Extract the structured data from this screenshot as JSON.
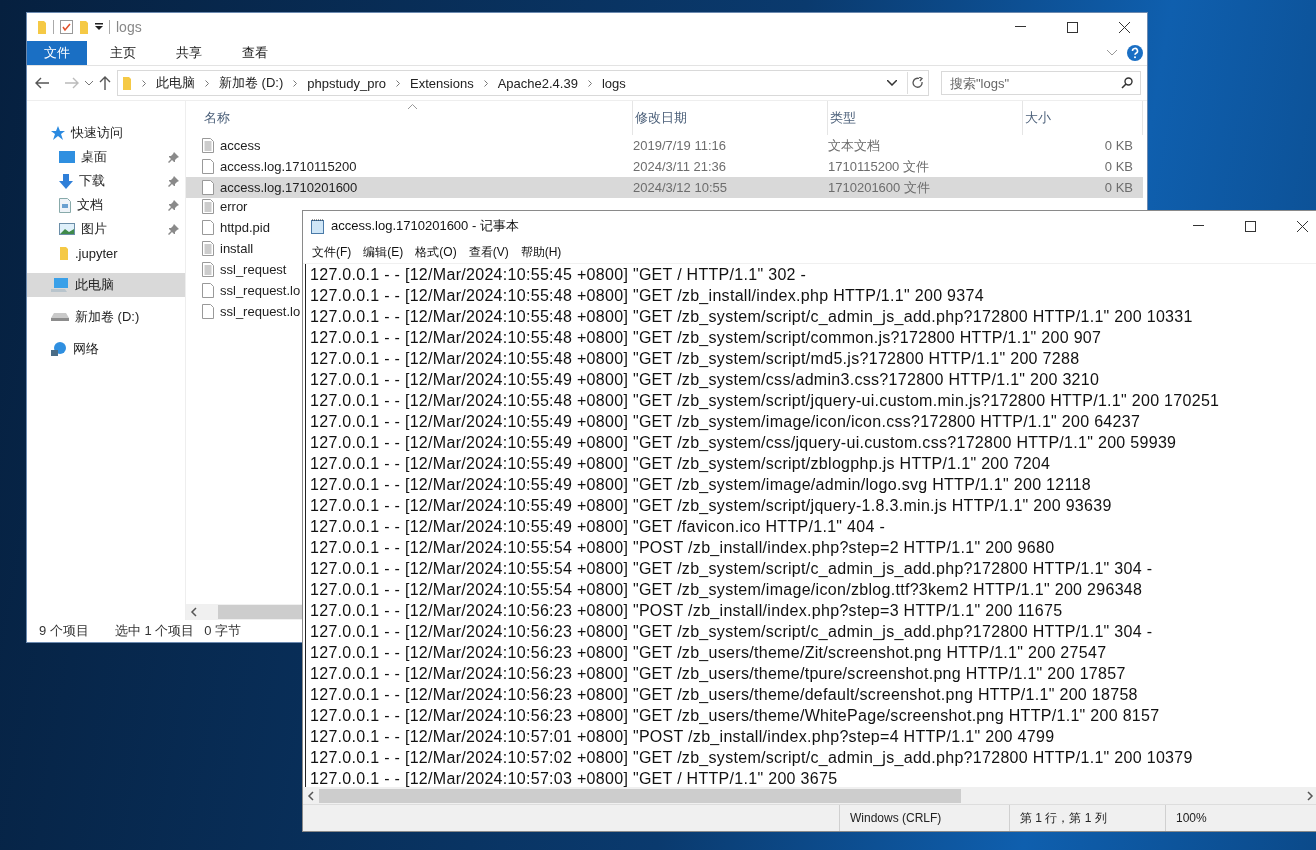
{
  "explorer": {
    "title": "logs",
    "ribbon_tabs": [
      {
        "label": "文件",
        "selected": true
      },
      {
        "label": "主页",
        "selected": false
      },
      {
        "label": "共享",
        "selected": false
      },
      {
        "label": "查看",
        "selected": false
      }
    ],
    "breadcrumb": [
      "此电脑",
      "新加卷 (D:)",
      "phpstudy_pro",
      "Extensions",
      "Apache2.4.39",
      "logs"
    ],
    "search": {
      "placeholder": "搜索\"logs\""
    },
    "sidebar": {
      "items": [
        {
          "label": "快速访问",
          "kind": "star",
          "pinned": false,
          "selected": false,
          "children": [
            {
              "label": "桌面",
              "kind": "desktop",
              "pinned": true,
              "selected": false
            },
            {
              "label": "下载",
              "kind": "download",
              "pinned": true,
              "selected": false
            },
            {
              "label": "文档",
              "kind": "document",
              "pinned": true,
              "selected": false
            },
            {
              "label": "图片",
              "kind": "picture",
              "pinned": true,
              "selected": false
            },
            {
              "label": ".jupyter",
              "kind": "folder",
              "pinned": false,
              "selected": false
            }
          ]
        },
        {
          "label": "此电脑",
          "kind": "computer",
          "pinned": false,
          "selected": true
        },
        {
          "label": "新加卷 (D:)",
          "kind": "drive",
          "pinned": false,
          "selected": false
        },
        {
          "label": "网络",
          "kind": "network",
          "pinned": false,
          "selected": false
        }
      ]
    },
    "columns": [
      "名称",
      "修改日期",
      "类型",
      "大小"
    ],
    "rows": [
      {
        "name": "access",
        "modified": "2019/7/19 11:16",
        "type": "文本文档",
        "size": "0 KB",
        "kind": "text",
        "selected": false
      },
      {
        "name": "access.log.1710115200",
        "modified": "2024/3/11 21:36",
        "type": "1710115200 文件",
        "size": "0 KB",
        "kind": "file",
        "selected": false
      },
      {
        "name": "access.log.1710201600",
        "modified": "2024/3/12 10:55",
        "type": "1710201600 文件",
        "size": "0 KB",
        "kind": "file",
        "selected": true
      },
      {
        "name": "error",
        "kind": "text",
        "selected": false
      },
      {
        "name": "httpd.pid",
        "kind": "file",
        "selected": false
      },
      {
        "name": "install",
        "kind": "text",
        "selected": false
      },
      {
        "name": "ssl_request",
        "kind": "text",
        "selected": false
      },
      {
        "name": "ssl_request.lo",
        "kind": "file",
        "selected": false
      },
      {
        "name": "ssl_request.lo",
        "kind": "file",
        "selected": false
      }
    ],
    "status": [
      "9 个项目",
      "选中 1 个项目",
      "0 字节"
    ]
  },
  "notepad": {
    "title": "access.log.1710201600 - 记事本",
    "menu": [
      "文件(F)",
      "编辑(E)",
      "格式(O)",
      "查看(V)",
      "帮助(H)"
    ],
    "lines": [
      "127.0.0.1 - - [12/Mar/2024:10:55:45 +0800] \"GET / HTTP/1.1\" 302 -",
      "127.0.0.1 - - [12/Mar/2024:10:55:48 +0800] \"GET /zb_install/index.php HTTP/1.1\" 200 9374",
      "127.0.0.1 - - [12/Mar/2024:10:55:48 +0800] \"GET /zb_system/script/c_admin_js_add.php?172800 HTTP/1.1\" 200 10331",
      "127.0.0.1 - - [12/Mar/2024:10:55:48 +0800] \"GET /zb_system/script/common.js?172800 HTTP/1.1\" 200 907",
      "127.0.0.1 - - [12/Mar/2024:10:55:48 +0800] \"GET /zb_system/script/md5.js?172800 HTTP/1.1\" 200 7288",
      "127.0.0.1 - - [12/Mar/2024:10:55:49 +0800] \"GET /zb_system/css/admin3.css?172800 HTTP/1.1\" 200 3210",
      "127.0.0.1 - - [12/Mar/2024:10:55:48 +0800] \"GET /zb_system/script/jquery-ui.custom.min.js?172800 HTTP/1.1\" 200 170251",
      "127.0.0.1 - - [12/Mar/2024:10:55:49 +0800] \"GET /zb_system/image/icon/icon.css?172800 HTTP/1.1\" 200 64237",
      "127.0.0.1 - - [12/Mar/2024:10:55:49 +0800] \"GET /zb_system/css/jquery-ui.custom.css?172800 HTTP/1.1\" 200 59939",
      "127.0.0.1 - - [12/Mar/2024:10:55:49 +0800] \"GET /zb_system/script/zblogphp.js HTTP/1.1\" 200 7204",
      "127.0.0.1 - - [12/Mar/2024:10:55:49 +0800] \"GET /zb_system/image/admin/logo.svg HTTP/1.1\" 200 12118",
      "127.0.0.1 - - [12/Mar/2024:10:55:49 +0800] \"GET /zb_system/script/jquery-1.8.3.min.js HTTP/1.1\" 200 93639",
      "127.0.0.1 - - [12/Mar/2024:10:55:49 +0800] \"GET /favicon.ico HTTP/1.1\" 404 -",
      "127.0.0.1 - - [12/Mar/2024:10:55:54 +0800] \"POST /zb_install/index.php?step=2 HTTP/1.1\" 200 9680",
      "127.0.0.1 - - [12/Mar/2024:10:55:54 +0800] \"GET /zb_system/script/c_admin_js_add.php?172800 HTTP/1.1\" 304 -",
      "127.0.0.1 - - [12/Mar/2024:10:55:54 +0800] \"GET /zb_system/image/icon/zblog.ttf?3kem2 HTTP/1.1\" 200 296348",
      "127.0.0.1 - - [12/Mar/2024:10:56:23 +0800] \"POST /zb_install/index.php?step=3 HTTP/1.1\" 200 11675",
      "127.0.0.1 - - [12/Mar/2024:10:56:23 +0800] \"GET /zb_system/script/c_admin_js_add.php?172800 HTTP/1.1\" 304 -",
      "127.0.0.1 - - [12/Mar/2024:10:56:23 +0800] \"GET /zb_users/theme/Zit/screenshot.png HTTP/1.1\" 200 27547",
      "127.0.0.1 - - [12/Mar/2024:10:56:23 +0800] \"GET /zb_users/theme/tpure/screenshot.png HTTP/1.1\" 200 17857",
      "127.0.0.1 - - [12/Mar/2024:10:56:23 +0800] \"GET /zb_users/theme/default/screenshot.png HTTP/1.1\" 200 18758",
      "127.0.0.1 - - [12/Mar/2024:10:56:23 +0800] \"GET /zb_users/theme/WhitePage/screenshot.png HTTP/1.1\" 200 8157",
      "127.0.0.1 - - [12/Mar/2024:10:57:01 +0800] \"POST /zb_install/index.php?step=4 HTTP/1.1\" 200 4799",
      "127.0.0.1 - - [12/Mar/2024:10:57:02 +0800] \"GET /zb_system/script/c_admin_js_add.php?172800 HTTP/1.1\" 200 10379",
      "127.0.0.1 - - [12/Mar/2024:10:57:03 +0800] \"GET / HTTP/1.1\" 200 3675"
    ],
    "status": [
      "Windows (CRLF)",
      "第 1 行，第 1 列",
      "100%"
    ]
  }
}
